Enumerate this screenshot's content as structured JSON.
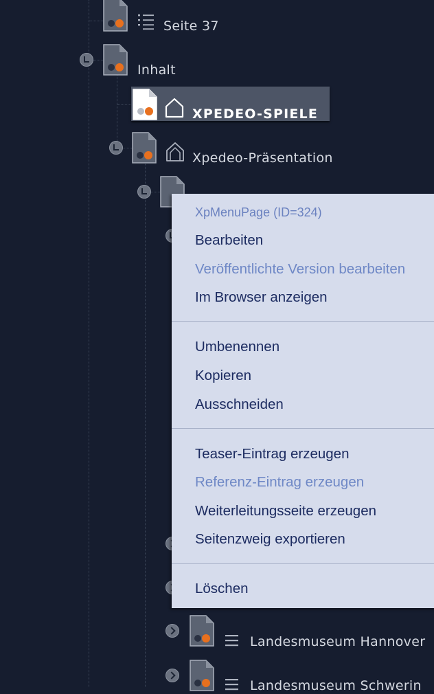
{
  "tree": {
    "nodes": [
      {
        "id": "seite-37",
        "label": "Seite 37",
        "type_icon": "list-icon"
      },
      {
        "id": "inhalt",
        "label": "Inhalt",
        "type_icon": ""
      },
      {
        "id": "xpedeo-spiele",
        "label": "XPEDEO-SPIELE",
        "type_icon": "home-icon",
        "selected": true
      },
      {
        "id": "xpedeo-praesentation",
        "label": "Xpedeo-Präsentation",
        "type_icon": "home-outline-icon"
      },
      {
        "id": "landesmuseum-hannover",
        "label": "Landesmuseum Hannover",
        "type_icon": "menu-icon"
      },
      {
        "id": "landesmuseum-schwerin",
        "label": "Landesmuseum Schwerin",
        "type_icon": "menu-icon"
      }
    ]
  },
  "context_menu": {
    "header": "XpMenuPage (ID=324)",
    "groups": [
      [
        {
          "label": "Bearbeiten",
          "enabled": true
        },
        {
          "label": "Veröffentlichte Version bearbeiten",
          "enabled": false
        },
        {
          "label": "Im Browser anzeigen",
          "enabled": true
        }
      ],
      [
        {
          "label": "Umbenennen",
          "enabled": true
        },
        {
          "label": "Kopieren",
          "enabled": true
        },
        {
          "label": "Ausschneiden",
          "enabled": true
        }
      ],
      [
        {
          "label": "Teaser-Eintrag erzeugen",
          "enabled": true
        },
        {
          "label": "Referenz-Eintrag erzeugen",
          "enabled": false
        },
        {
          "label": "Weiterleitungsseite erzeugen",
          "enabled": true
        },
        {
          "label": "Seitenzweig exportieren",
          "enabled": true
        }
      ],
      [
        {
          "label": "Löschen",
          "enabled": true
        }
      ]
    ]
  },
  "colors": {
    "background": "#161d2f",
    "selected_row": "#4d5566",
    "menu_background": "#d6dcec",
    "menu_text": "#1d2c61",
    "menu_disabled": "#6f88c6",
    "accent_orange": "#e8701e"
  }
}
